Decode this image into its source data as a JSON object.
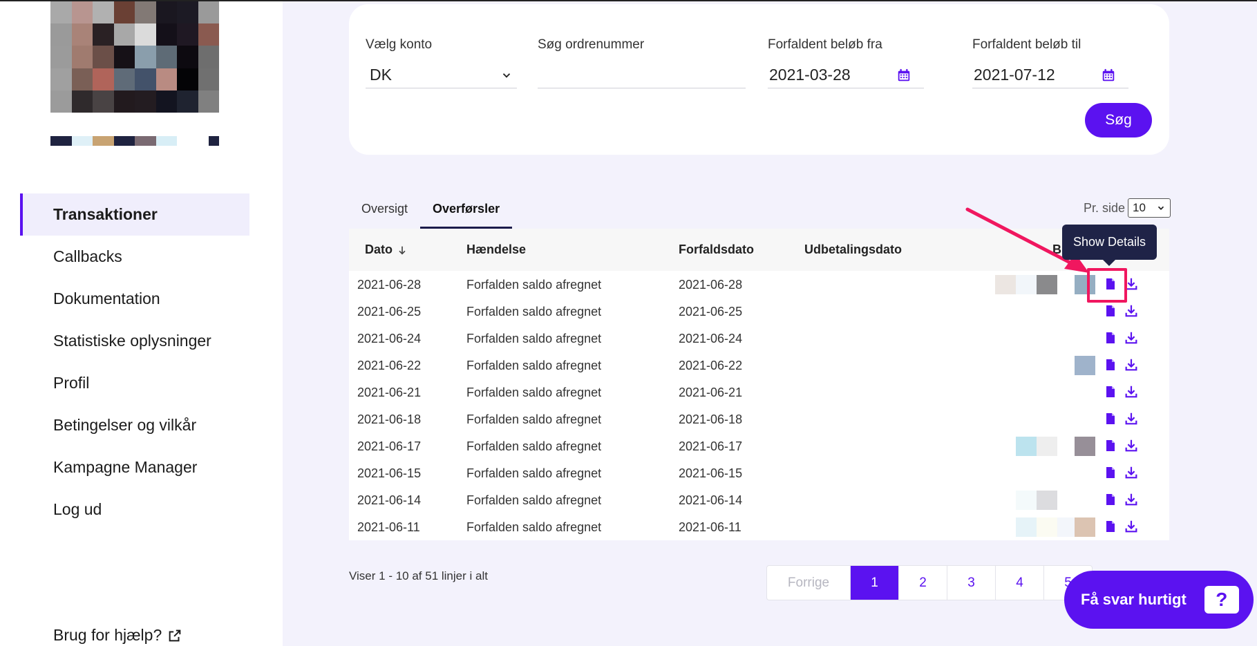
{
  "colors": {
    "accent": "#5b12f0",
    "highlight": "#f0175f",
    "tooltip_bg": "#1f2347"
  },
  "sidebar": {
    "logo_icon": "pixelated-logo",
    "items": [
      {
        "label": "Transaktioner",
        "active": true
      },
      {
        "label": "Callbacks"
      },
      {
        "label": "Dokumentation"
      },
      {
        "label": "Statistiske oplysninger"
      },
      {
        "label": "Profil"
      },
      {
        "label": "Betingelser og vilkår"
      },
      {
        "label": "Kampagne Manager"
      },
      {
        "label": "Log ud"
      }
    ],
    "help_label": "Brug for hjælp?",
    "help_icon": "external-link-icon"
  },
  "filters": {
    "account": {
      "label": "Vælg konto",
      "value": "DK"
    },
    "order": {
      "label": "Søg ordrenummer",
      "value": ""
    },
    "amount_from": {
      "label": "Forfaldent beløb fra",
      "value": "2021-03-28"
    },
    "amount_to": {
      "label": "Forfaldent beløb til",
      "value": "2021-07-12"
    },
    "search_label": "Søg"
  },
  "tabs": [
    {
      "label": "Oversigt",
      "active": false
    },
    {
      "label": "Overførsler",
      "active": true
    }
  ],
  "per_page": {
    "label": "Pr. side",
    "value": "10"
  },
  "table": {
    "headers": {
      "date": "Dato",
      "event": "Hændelse",
      "due": "Forfaldsdato",
      "payout": "Udbetalingsdato",
      "amount_partial": "B"
    },
    "rows": [
      {
        "date": "2021-06-28",
        "event": "Forfalden saldo afregnet",
        "due": "2021-06-28"
      },
      {
        "date": "2021-06-25",
        "event": "Forfalden saldo afregnet",
        "due": "2021-06-25"
      },
      {
        "date": "2021-06-24",
        "event": "Forfalden saldo afregnet",
        "due": "2021-06-24"
      },
      {
        "date": "2021-06-22",
        "event": "Forfalden saldo afregnet",
        "due": "2021-06-22"
      },
      {
        "date": "2021-06-21",
        "event": "Forfalden saldo afregnet",
        "due": "2021-06-21"
      },
      {
        "date": "2021-06-18",
        "event": "Forfalden saldo afregnet",
        "due": "2021-06-18"
      },
      {
        "date": "2021-06-17",
        "event": "Forfalden saldo afregnet",
        "due": "2021-06-17"
      },
      {
        "date": "2021-06-15",
        "event": "Forfalden saldo afregnet",
        "due": "2021-06-15"
      },
      {
        "date": "2021-06-14",
        "event": "Forfalden saldo afregnet",
        "due": "2021-06-14"
      },
      {
        "date": "2021-06-11",
        "event": "Forfalden saldo afregnet",
        "due": "2021-06-11"
      }
    ]
  },
  "tooltip": {
    "text": "Show Details"
  },
  "footer": {
    "showing": "Viser 1 - 10 af 51 linjer i alt",
    "pager": {
      "prev": "Forrige",
      "pages": [
        "1",
        "2",
        "3",
        "4",
        "5"
      ],
      "current": "1"
    }
  },
  "chat": {
    "label": "Få svar hurtigt",
    "icon_text": "?"
  }
}
